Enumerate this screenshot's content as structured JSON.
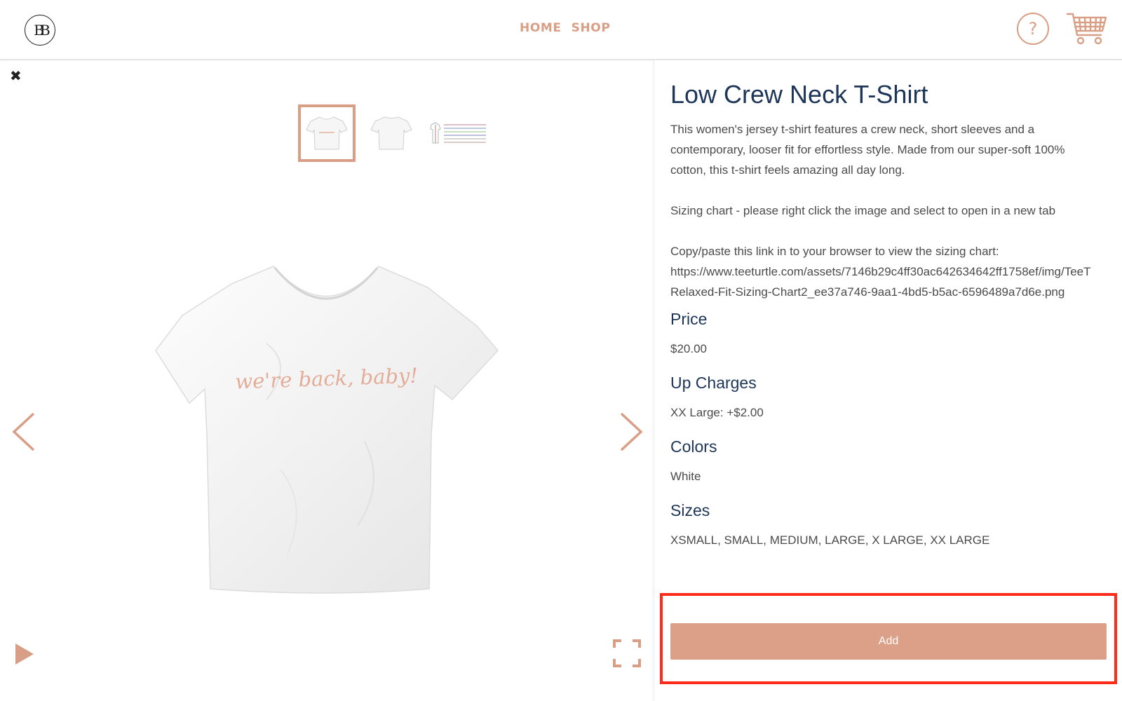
{
  "header": {
    "logo_text": "BB",
    "nav": {
      "home": "HOME",
      "shop": "SHOP"
    },
    "help_glyph": "?",
    "accent_color": "#d99f86"
  },
  "gallery": {
    "shirt_print_text": "we're back, baby!"
  },
  "product": {
    "title": "Low Crew Neck T-Shirt",
    "description_lines": [
      "This women's jersey t-shirt features a crew neck, short sleeves and a",
      "contemporary, looser fit for effortless style. Made from our super-soft 100%",
      "cotton, this t-shirt feels amazing all day long.",
      "Sizing chart - please right click the image and select to open in a new tab",
      "Copy/paste this link in to your browser to view the sizing chart:",
      "https://www.teeturtle.com/assets/7146b29c4ff30ac642634642ff1758ef/img/TeeT",
      "Relaxed-Fit-Sizing-Chart2_ee37a746-9aa1-4bd5-b5ac-6596489a7d6e.png"
    ],
    "price_label": "Price",
    "price_value": "$20.00",
    "upcharges_label": "Up Charges",
    "upcharges_value": "XX Large: +$2.00",
    "colors_label": "Colors",
    "colors_value": "White",
    "sizes_label": "Sizes",
    "sizes_value": "XSMALL, SMALL, MEDIUM, LARGE, X LARGE, XX LARGE",
    "add_label": "Add",
    "button_color": "#dca088",
    "title_color": "#1d3557"
  }
}
